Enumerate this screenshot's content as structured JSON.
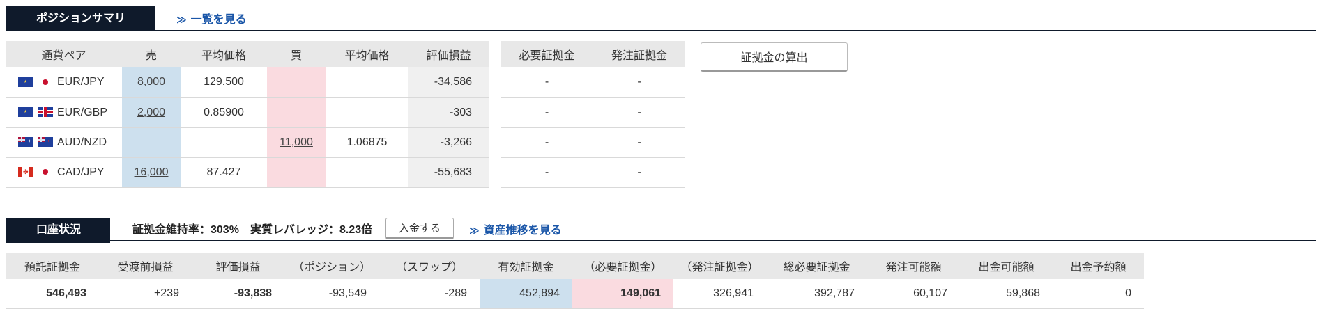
{
  "position_summary": {
    "title": "ポジションサマリ",
    "list_link": "一覧を見る",
    "headers": [
      "通貨ペア",
      "売",
      "平均価格",
      "買",
      "平均価格",
      "評価損益"
    ],
    "rows": [
      {
        "pair": "EUR/JPY",
        "flags": [
          "eu-flag-icon",
          "jp-flag-icon"
        ],
        "sell": "8,000",
        "sell_avg": "129.500",
        "buy": "",
        "buy_avg": "",
        "pl": "-34,586"
      },
      {
        "pair": "EUR/GBP",
        "flags": [
          "eu-flag-icon",
          "gb-flag-icon"
        ],
        "sell": "2,000",
        "sell_avg": "0.85900",
        "buy": "",
        "buy_avg": "",
        "pl": "-303"
      },
      {
        "pair": "AUD/NZD",
        "flags": [
          "au-flag-icon",
          "nz-flag-icon"
        ],
        "sell": "",
        "sell_avg": "",
        "buy": "11,000",
        "buy_avg": "1.06875",
        "pl": "-3,266"
      },
      {
        "pair": "CAD/JPY",
        "flags": [
          "ca-flag-icon",
          "jp-flag-icon"
        ],
        "sell": "16,000",
        "sell_avg": "87.427",
        "buy": "",
        "buy_avg": "",
        "pl": "-55,683"
      }
    ],
    "margin_headers": [
      "必要証拠金",
      "発注証拠金"
    ],
    "margin_rows": [
      [
        "-",
        "-"
      ],
      [
        "-",
        "-"
      ],
      [
        "-",
        "-"
      ],
      [
        "-",
        "-"
      ]
    ],
    "calc_button": "証拠金の算出"
  },
  "account_status": {
    "title": "口座状況",
    "maintenance_ratio": "証拠金維持率：303%",
    "leverage": "実質レバレッジ：8.23倍",
    "deposit_button": "入金する",
    "history_link": "資産推移を見る",
    "headers": [
      "預託証拠金",
      "受渡前損益",
      "評価損益",
      "（ポジション）",
      "（スワップ）",
      "有効証拠金",
      "（必要証拠金）",
      "（発注証拠金）",
      "総必要証拠金",
      "発注可能額",
      "出金可能額",
      "出金予約額"
    ],
    "values": [
      "546,493",
      "+239",
      "-93,838",
      "-93,549",
      "-289",
      "452,894",
      "149,061",
      "326,941",
      "392,787",
      "60,107",
      "59,868",
      "0"
    ]
  },
  "colors": {
    "header_navy": "#0f1a2b",
    "link_blue": "#1a56a8",
    "sell_bg": "#cde0ee",
    "buy_bg": "#fadbe0"
  }
}
